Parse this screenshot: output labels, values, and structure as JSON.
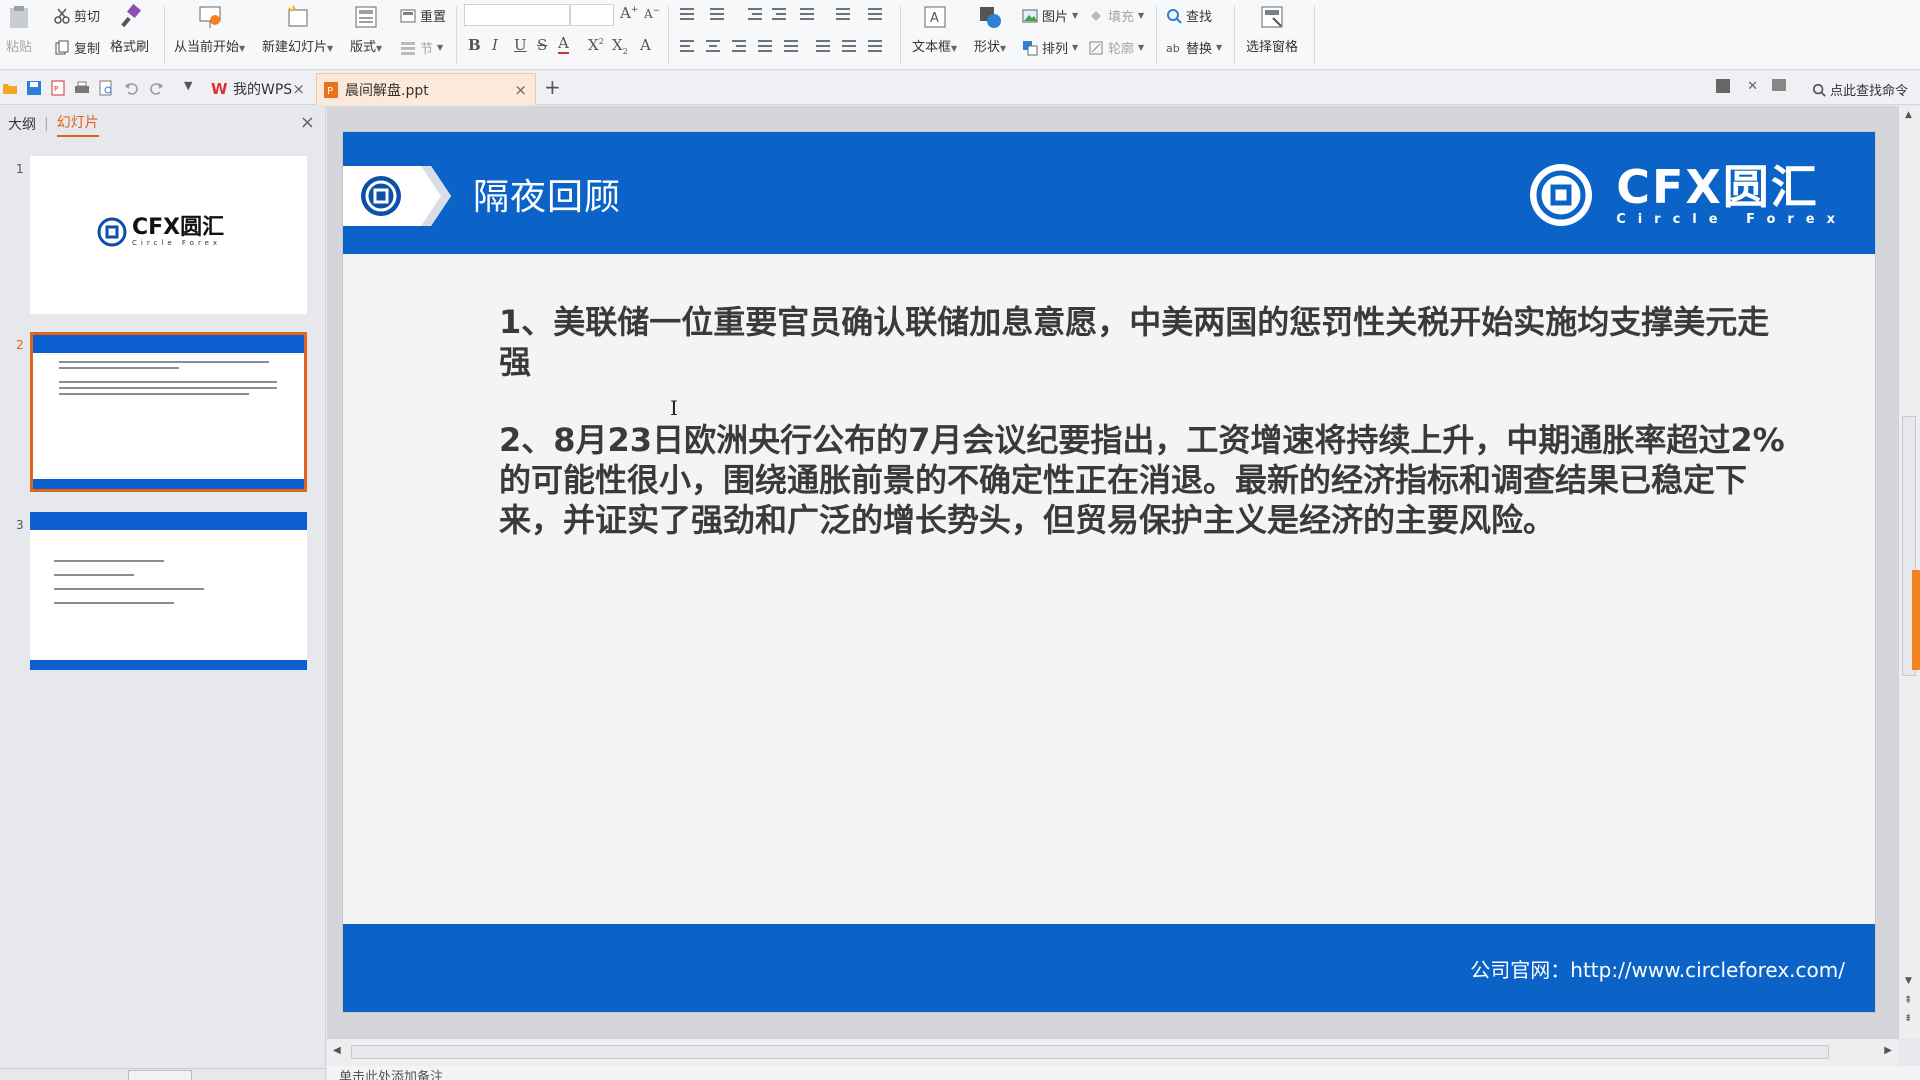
{
  "ribbon": {
    "paste": "粘贴",
    "cut": "剪切",
    "copy": "复制",
    "format_painter": "格式刷",
    "from_current": "从当前开始",
    "new_slide": "新建幻灯片",
    "layout": "版式",
    "reset": "重置",
    "section": "节",
    "textbox": "文本框",
    "shape": "形状",
    "picture": "图片",
    "fill": "填充",
    "arrange": "排列",
    "outline": "轮廓",
    "find": "查找",
    "replace": "替换",
    "selection_pane": "选择窗格"
  },
  "tabbar": {
    "wps_tab": "我的WPS",
    "doc_tab": "晨间解盘.ppt",
    "find_command": "点此查找命令"
  },
  "panel": {
    "tab_outline": "大纲",
    "tab_slides": "幻灯片",
    "slide_numbers": [
      "1",
      "2",
      "3"
    ],
    "thumb1_brand": "CFX圆汇",
    "thumb1_sub": "Circle Forex"
  },
  "slide": {
    "title": "隔夜回顾",
    "brand_main": "CFX圆汇",
    "brand_sub": "Circle Forex",
    "paragraphs": [
      "1、美联储一位重要官员确认联储加息意愿，中美两国的惩罚性关税开始实施均支撑美元走强",
      "2、8月23日欧洲央行公布的7月会议纪要指出，工资增速将持续上升，中期通胀率超过2%的可能性很小，围绕通胀前景的不确定性正在消退。最新的经济指标和调查结果已稳定下来，并证实了强劲和广泛的增长势头，但贸易保护主义是经济的主要风险。"
    ],
    "footer": "公司官网：http://www.circleforex.com/"
  },
  "notes_placeholder": "单击此处添加备注",
  "colors": {
    "accent_blue": "#0b63c8",
    "accent_orange": "#e0641c"
  }
}
